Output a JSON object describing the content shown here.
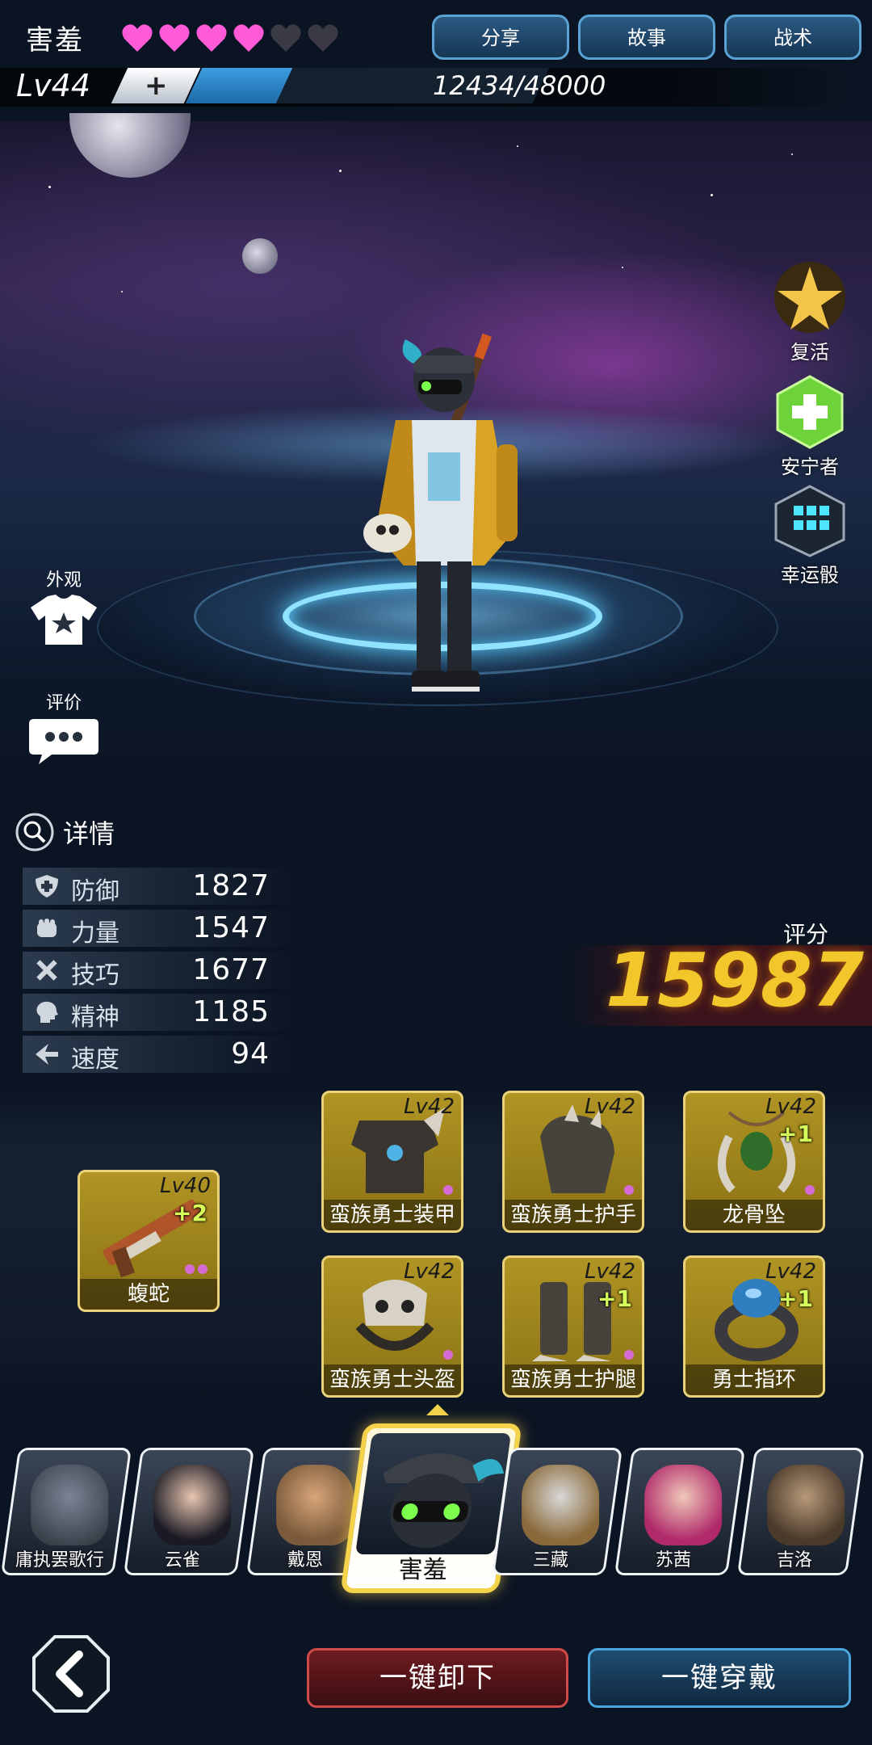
{
  "hero": {
    "name": "害羞",
    "hearts_filled": 4,
    "hearts_total": 6,
    "level": "Lv44",
    "plus_label": "+",
    "xp_text": "12434/48000",
    "xp_fraction": 0.26
  },
  "top_tabs": [
    {
      "label": "分享"
    },
    {
      "label": "故事"
    },
    {
      "label": "战术"
    }
  ],
  "side_buttons": [
    {
      "label": "复活",
      "icon": "revive-icon"
    },
    {
      "label": "安宁者",
      "icon": "peacekeeper-icon"
    },
    {
      "label": "幸运骰",
      "icon": "lucky-dice-icon"
    }
  ],
  "left_buttons": [
    {
      "label": "外观",
      "icon": "shirt-icon"
    },
    {
      "label": "评价",
      "icon": "chat-bubble-icon"
    }
  ],
  "details": {
    "label": "详情",
    "stats": [
      {
        "label": "防御",
        "value": "1827",
        "icon": "shield-icon"
      },
      {
        "label": "力量",
        "value": "1547",
        "icon": "fist-icon"
      },
      {
        "label": "技巧",
        "value": "1677",
        "icon": "tools-icon"
      },
      {
        "label": "精神",
        "value": "1185",
        "icon": "head-icon"
      },
      {
        "label": "速度",
        "value": "94",
        "icon": "speed-icon"
      }
    ]
  },
  "score": {
    "label": "评分",
    "value": "15987"
  },
  "weapon": {
    "level": "Lv40",
    "plus": "+2",
    "name": "蝮蛇"
  },
  "equipment": [
    {
      "level": "Lv42",
      "plus": "",
      "name": "蛮族勇士装甲"
    },
    {
      "level": "Lv42",
      "plus": "",
      "name": "蛮族勇士护手"
    },
    {
      "level": "Lv42",
      "plus": "+1",
      "name": "龙骨坠"
    },
    {
      "level": "Lv42",
      "plus": "",
      "name": "蛮族勇士头盔"
    },
    {
      "level": "Lv42",
      "plus": "+1",
      "name": "蛮族勇士护腿"
    },
    {
      "level": "Lv42",
      "plus": "+1",
      "name": "勇士指环"
    }
  ],
  "roster": [
    {
      "name": "庸执罢歌行"
    },
    {
      "name": "云雀"
    },
    {
      "name": "戴恩"
    },
    {
      "name": "害羞",
      "active": true
    },
    {
      "name": "三藏"
    },
    {
      "name": "苏茜"
    },
    {
      "name": "吉洛"
    }
  ],
  "bottom": {
    "back_icon": "chevron-left-icon",
    "unequip_label": "一键卸下",
    "equip_label": "一键穿戴"
  },
  "colors": {
    "score": "#f2c72c",
    "heart_filled": "#ff5bd8",
    "heart_empty": "#3a3a44",
    "unequip_border": "#d14a4a",
    "equip_border": "#4aa6dc",
    "slot_gold": "#b09424"
  }
}
